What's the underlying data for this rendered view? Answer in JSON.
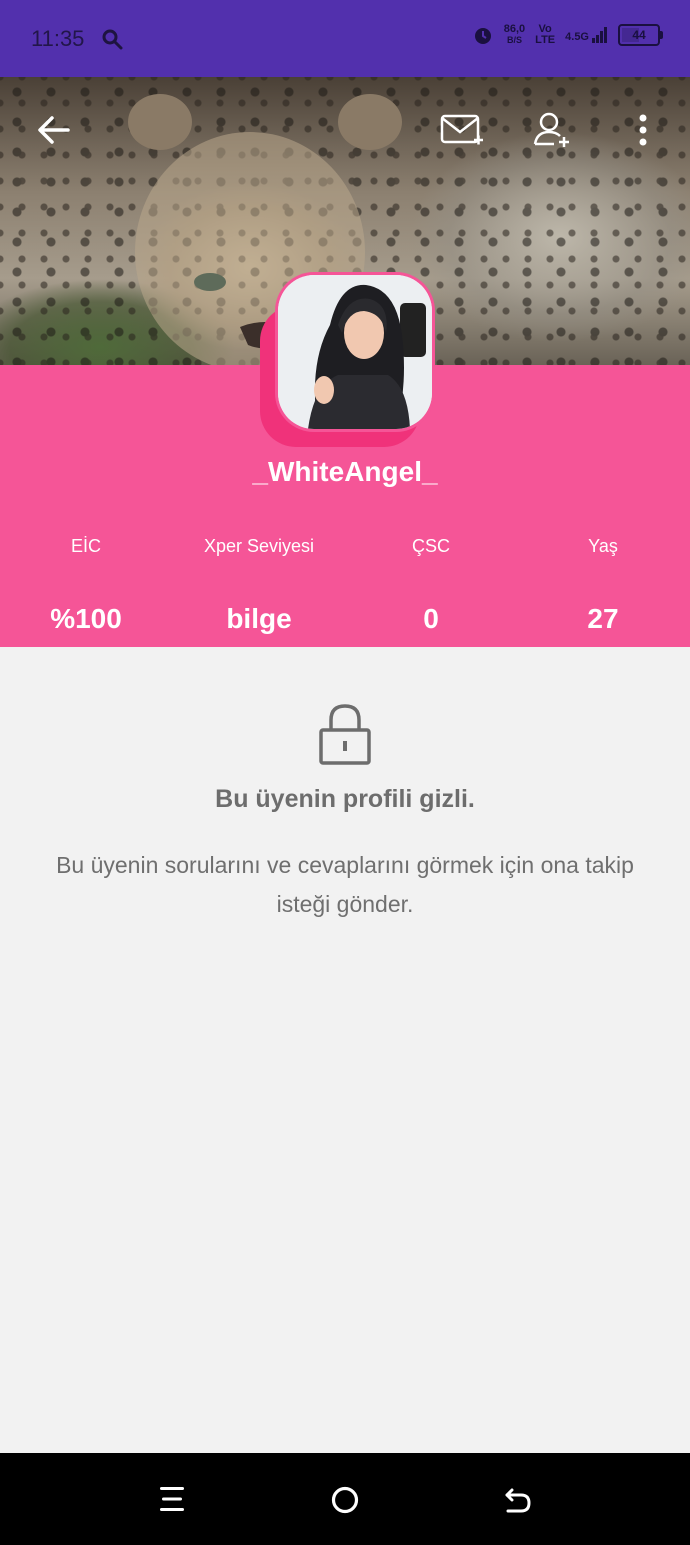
{
  "status_bar": {
    "time": "11:35",
    "speed_value": "86,0",
    "speed_unit": "B/S",
    "volte_top": "Vo",
    "volte_bottom": "LTE",
    "network": "4.5G",
    "battery": "44",
    "icons": [
      "search-icon",
      "alarm-icon",
      "signal-icon",
      "battery-icon"
    ]
  },
  "top_bar": {
    "icons": [
      "back-arrow-icon",
      "message-add-icon",
      "follow-user-icon",
      "more-vert-icon"
    ]
  },
  "profile": {
    "username": "_WhiteAngel_",
    "stats": [
      {
        "label": "EİC",
        "value": "%100"
      },
      {
        "label": "Xper Seviyesi",
        "value": "bilge"
      },
      {
        "label": "ÇSC",
        "value": "0"
      },
      {
        "label": "Yaş",
        "value": "27"
      }
    ]
  },
  "private_notice": {
    "title": "Bu üyenin profili gizli.",
    "description": "Bu üyenin sorularını ve cevaplarını görmek için ona takip isteği gönder."
  },
  "nav_bar": {
    "icons": [
      "menu-icon",
      "home-circle-icon",
      "back-return-icon"
    ]
  },
  "colors": {
    "status_bar_bg": "#5230ad",
    "profile_bg": "#f55597",
    "content_bg": "#f2f2f2"
  }
}
